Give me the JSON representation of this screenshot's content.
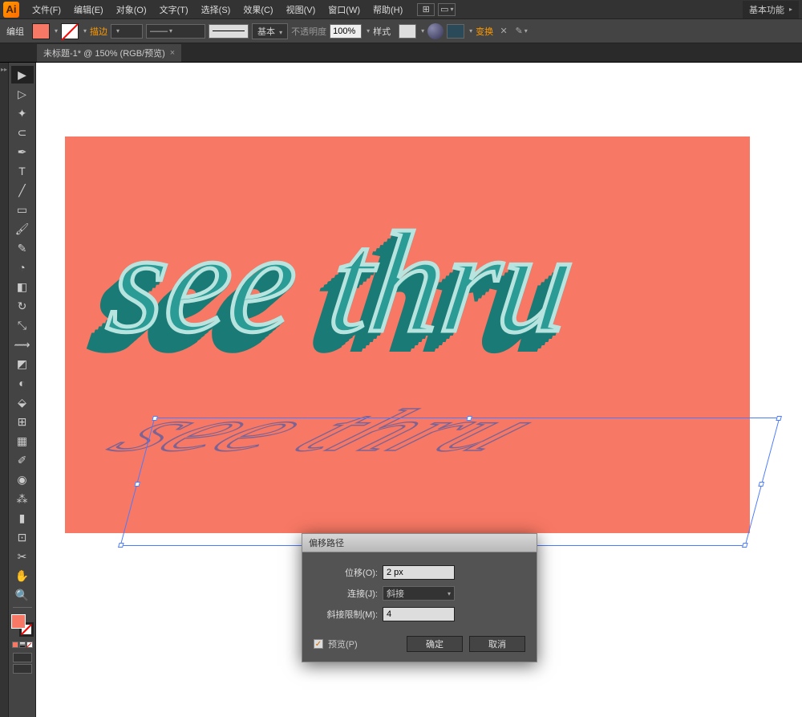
{
  "menu": {
    "file": "文件(F)",
    "edit": "编辑(E)",
    "object": "对象(O)",
    "text": "文字(T)",
    "select": "选择(S)",
    "effect": "效果(C)",
    "view": "视图(V)",
    "window": "窗口(W)",
    "help": "帮助(H)",
    "workspace": "基本功能"
  },
  "control": {
    "group_label": "编组",
    "stroke_label": "描边",
    "basic": "基本",
    "opacity_label": "不透明度",
    "opacity_value": "100%",
    "style_label": "样式",
    "transform_label": "变换"
  },
  "tab": {
    "title": "未标题-1* @ 150% (RGB/预览)"
  },
  "artwork": {
    "text": "see thru"
  },
  "dialog": {
    "title": "偏移路径",
    "offset_label": "位移(O):",
    "offset_value": "2 px",
    "join_label": "连接(J):",
    "join_value": "斜接",
    "miter_label": "斜接限制(M):",
    "miter_value": "4",
    "preview_label": "预览(P)",
    "ok": "确定",
    "cancel": "取消"
  }
}
